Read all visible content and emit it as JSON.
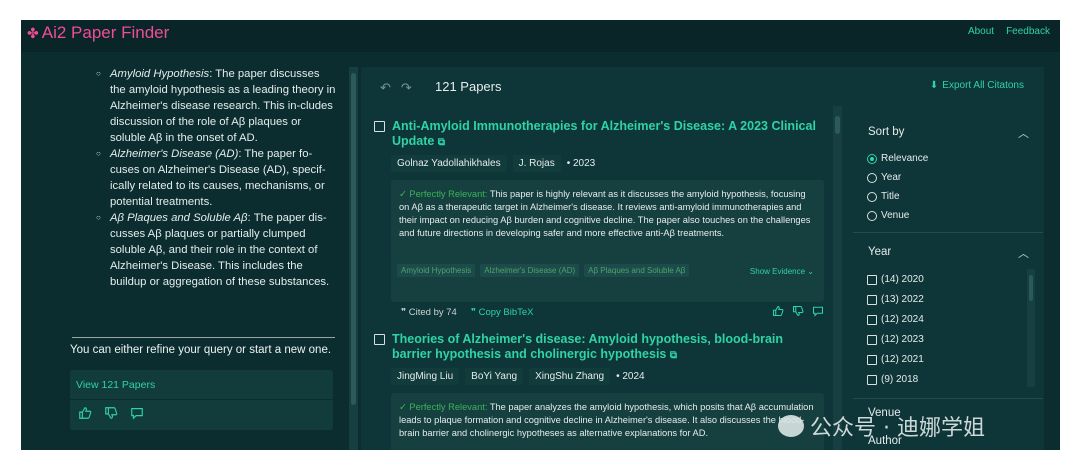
{
  "app": {
    "logo": "Ai2 Paper Finder",
    "nav": {
      "about": "About",
      "feedback": "Feedback"
    }
  },
  "chat": {
    "bullets": [
      {
        "term": "Amyloid Hypothesis",
        "text": ": The paper discusses the amyloid hypothesis as a leading theory in Alzheimer's disease research. This in-cludes discussion of the role of Aβ plaques or soluble Aβ in the onset of AD."
      },
      {
        "term": "Alzheimer's Disease (AD)",
        "text": ": The paper fo-cuses on Alzheimer's Disease (AD), specif-ically related to its causes, mechanisms, or potential treatments."
      },
      {
        "term": "Aβ Plaques and Soluble Aβ",
        "text": ": The paper dis-cusses Aβ plaques or partially clumped soluble Aβ, and their role in the context of Alzheimer's Disease. This includes the buildup or aggregation of these substances."
      }
    ],
    "refine_text": "You can either refine your query or start a new one.",
    "view_link": "View 121 Papers"
  },
  "results": {
    "count": "121 Papers",
    "export": "Export All Citatons",
    "papers": [
      {
        "title": "Anti-Amyloid Immunotherapies for Alzheimer's Disease: A 2023 Clinical Update",
        "authors": [
          "Golnaz Yadollahikhales",
          "J. Rojas"
        ],
        "year": "2023",
        "relevance": "Perfectly Relevant:",
        "evidence": "This paper is highly relevant as it discusses the amyloid hypothesis, focusing on Aβ as a therapeutic target in Alzheimer's disease. It reviews anti-amyloid immunotherapies and their impact on reducing Aβ burden and cognitive decline. The paper also touches on the challenges and future directions in developing safer and more effective anti-Aβ treatments.",
        "tags": [
          "Amyloid Hypothesis",
          "Alzheimer's Disease (AD)",
          "Aβ Plaques and Soluble Aβ"
        ],
        "show_evidence": "Show Evidence",
        "cited": "Cited by 74",
        "bibtex": "Copy BibTeX"
      },
      {
        "title": "Theories of Alzheimer's disease: Amyloid hypothesis, blood-brain barrier hypothesis and cholinergic hypothesis",
        "authors": [
          "JingMing Liu",
          "BoYi Yang",
          "XingShu Zhang"
        ],
        "year": "2024",
        "relevance": "Perfectly Relevant:",
        "evidence": "The paper analyzes the amyloid hypothesis, which posits that Aβ accumulation leads to plaque formation and cognitive decline in Alzheimer's disease. It also discusses the blood-brain barrier and cholinergic hypotheses as alternative explanations for AD."
      }
    ]
  },
  "sort": {
    "heading": "Sort by",
    "options": [
      "Relevance",
      "Year",
      "Title",
      "Venue"
    ],
    "selected": "Relevance",
    "year_heading": "Year",
    "years": [
      "(14) 2020",
      "(13) 2022",
      "(12) 2024",
      "(12) 2023",
      "(12) 2021",
      "(9) 2018"
    ],
    "venue_heading": "Venue",
    "author_heading": "Author"
  },
  "watermark": "公众号 · 迪娜学姐",
  "colors": {
    "accent": "#2fd3a6",
    "logo": "#f04d98",
    "background": "#0b2d2f",
    "relevant": "#3bb35a"
  }
}
